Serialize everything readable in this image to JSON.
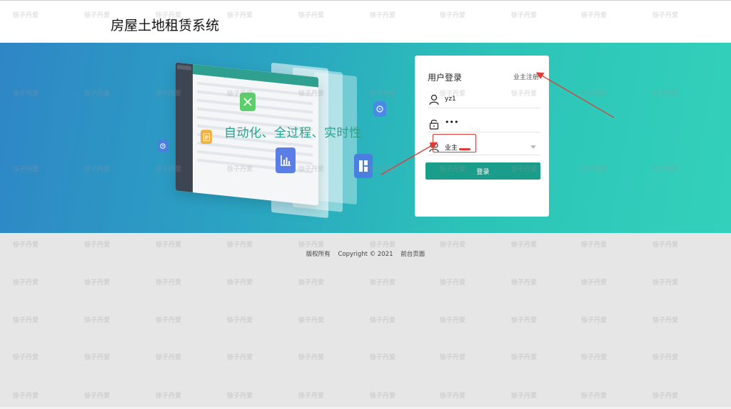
{
  "header": {
    "site_title": "房屋土地租赁系统"
  },
  "banner": {
    "slogan": "自动化、全过程、实时性"
  },
  "login": {
    "title": "用户登录",
    "register_link": "业主注册",
    "username_value": "yz1",
    "password_value": "•••",
    "role_value": "业主",
    "submit_label": "登录"
  },
  "footer": {
    "rights": "版权所有",
    "copyright": "Copyright © 2021",
    "front_page": "前台页面"
  },
  "watermark_text": "徐子丹爱",
  "colors": {
    "primary": "#1a9e8b",
    "banner_start": "#2f86c6",
    "banner_end": "#33d1bb",
    "annotation_red": "#e53935"
  }
}
